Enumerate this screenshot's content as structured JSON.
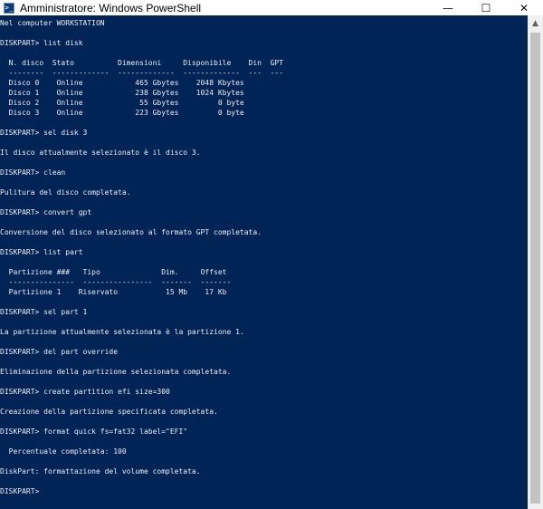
{
  "window": {
    "title": "Amministratore: Windows PowerShell",
    "icon_text": ">_",
    "controls": {
      "minimize": "—",
      "maximize": "☐",
      "close": "✕"
    }
  },
  "console": {
    "background": "#012456",
    "text": "Nel computer WORKSTATION\n\nDISKPART> list disk\n\n  N. disco  Stato          Dimensioni     Disponibile    Din  GPT\n  --------  -------------  -------------  -------------  ---  ---\n  Disco 0    Online            465 Gbytes    2048 Kbytes\n  Disco 1    Online            238 Gbytes    1024 Kbytes\n  Disco 2    Online             55 Gbytes         0 byte\n  Disco 3    Online            223 Gbytes         0 byte\n\nDISKPART> sel disk 3\n\nIl disco attualmente selezionato è il disco 3.\n\nDISKPART> clean\n\nPulitura del disco completata.\n\nDISKPART> convert gpt\n\nConversione del disco selezionato al formato GPT completata.\n\nDISKPART> list part\n\n  Partizione ###   Tipo              Dim.     Offset\n  ---------------  ----------------  -------  -------\n  Partizione 1    Riservato           15 Mb    17 Kb\n\nDISKPART> sel part 1\n\nLa partizione attualmente selezionata è la partizione 1.\n\nDISKPART> del part override\n\nEliminazione della partizione selezionata completata.\n\nDISKPART> create partition efi size=300\n\nCreazione della partizione specificata completata.\n\nDISKPART> format quick fs=fat32 label=\"EFI\"\n\n  Percentuale completata: 100\n\nDiskPart: formattazione del volume completata.\n\nDISKPART>"
  }
}
